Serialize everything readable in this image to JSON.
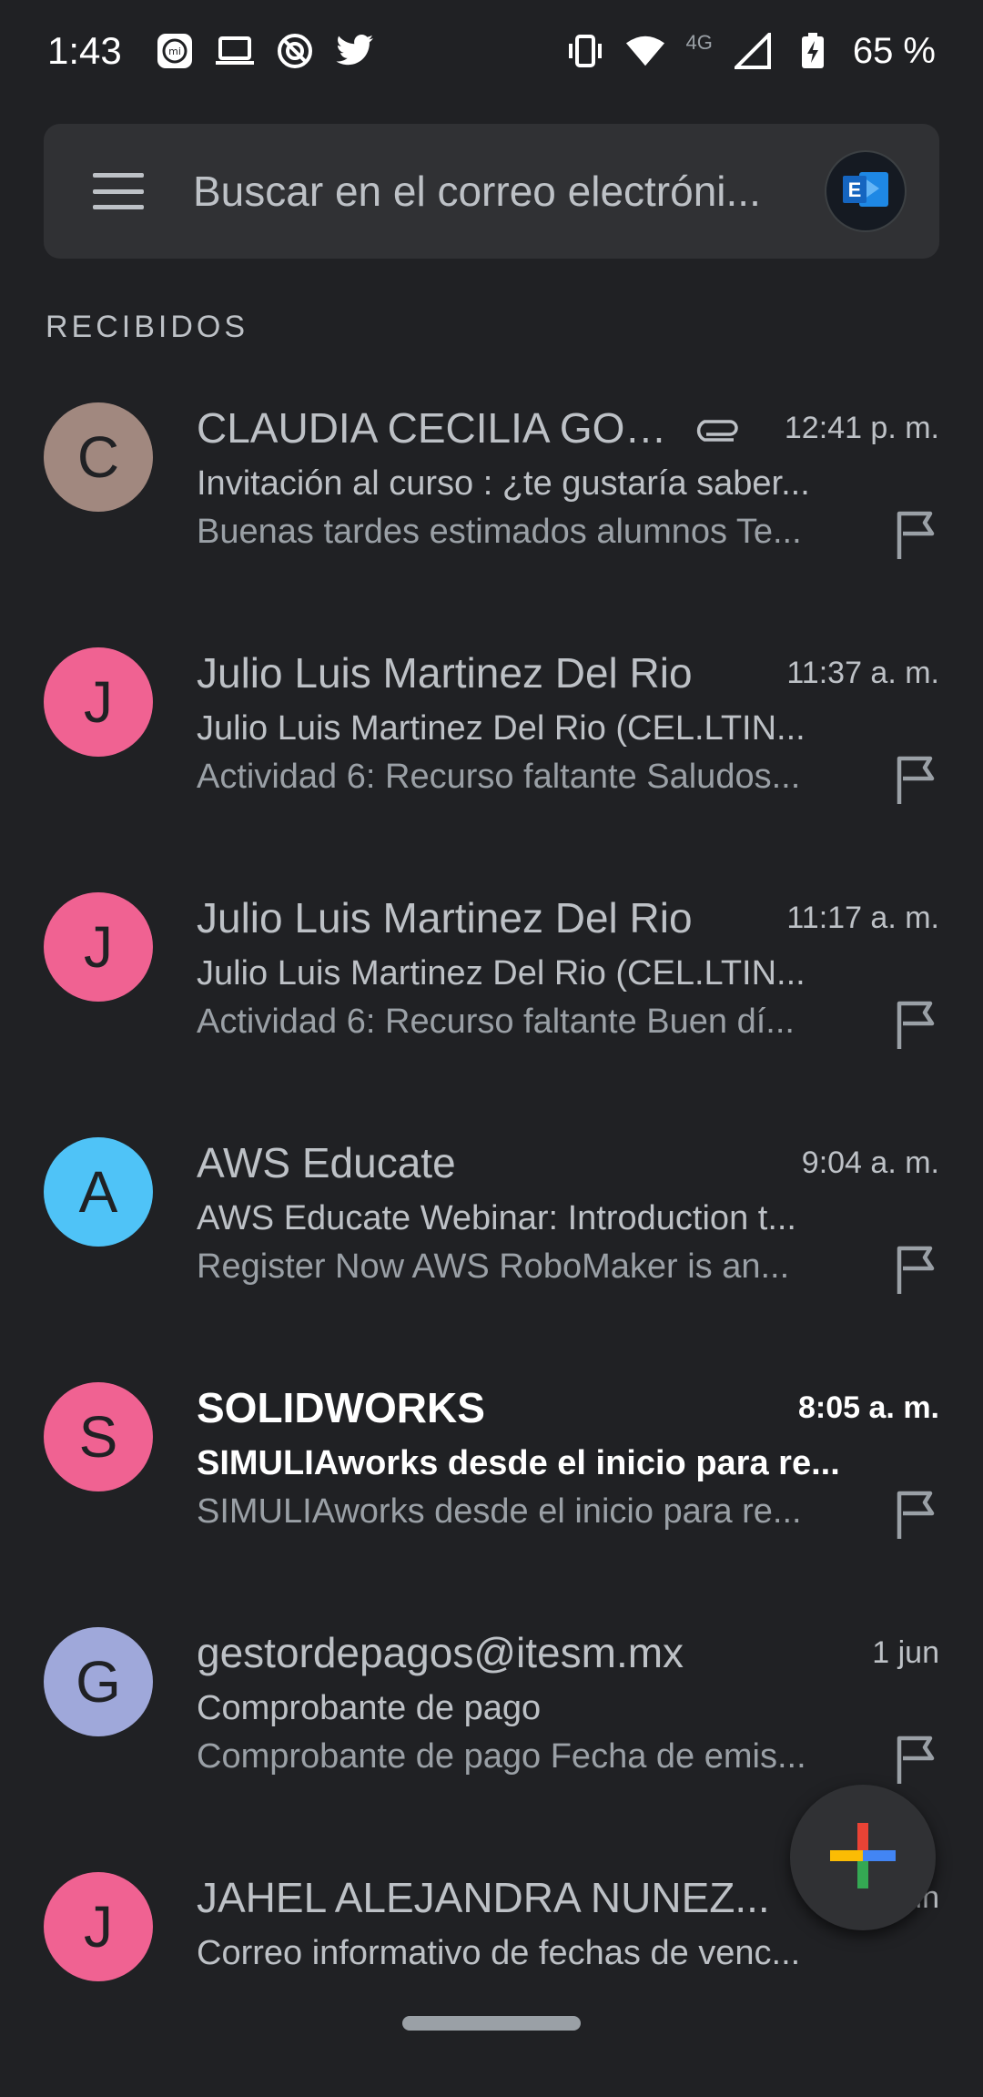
{
  "status_bar": {
    "time": "1:43",
    "network_label": "4G",
    "battery": "65 %",
    "icons": [
      "mi-icon",
      "laptop-icon",
      "sync-icon",
      "twitter-icon",
      "vibrate-icon",
      "wifi-icon",
      "signal-icon",
      "battery-icon"
    ]
  },
  "search": {
    "placeholder": "Buscar en el correo electróni...",
    "account_icon": "exchange-icon"
  },
  "section_label": "RECIBIDOS",
  "colors": {
    "background": "#202124",
    "surface": "#303134",
    "avatar_brown": "#a1887f",
    "avatar_pink": "#f06292",
    "avatar_blue": "#4fc3f7",
    "avatar_lavender": "#9fa8da"
  },
  "emails": [
    {
      "initial": "C",
      "sender": "CLAUDIA CECILIA GON...",
      "time": "12:41 p. m.",
      "subject": "Invitación al curso : ¿te gustaría saber...",
      "snippet": "Buenas tardes estimados alumnos Te...",
      "attachment": true,
      "unread": false,
      "avatar_color": "#a1887f"
    },
    {
      "initial": "J",
      "sender": "Julio Luis Martinez Del Rio",
      "time": "11:37 a. m.",
      "subject": "Julio Luis Martinez Del Rio (CEL.LTIN...",
      "snippet": "Actividad 6: Recurso faltante Saludos...",
      "attachment": false,
      "unread": false,
      "avatar_color": "#f06292"
    },
    {
      "initial": "J",
      "sender": "Julio Luis Martinez Del Rio",
      "time": "11:17 a. m.",
      "subject": "Julio Luis Martinez Del Rio (CEL.LTIN...",
      "snippet": "Actividad 6: Recurso faltante Buen dí...",
      "attachment": false,
      "unread": false,
      "avatar_color": "#f06292"
    },
    {
      "initial": "A",
      "sender": "AWS Educate",
      "time": "9:04 a. m.",
      "subject": "AWS Educate Webinar: Introduction t...",
      "snippet": "Register Now AWS RoboMaker is an...",
      "attachment": false,
      "unread": false,
      "avatar_color": "#4fc3f7"
    },
    {
      "initial": "S",
      "sender": "SOLIDWORKS",
      "time": "8:05 a. m.",
      "subject": "SIMULIAworks desde el inicio para re...",
      "snippet": "SIMULIAworks desde el inicio para re...",
      "attachment": false,
      "unread": true,
      "avatar_color": "#f06292"
    },
    {
      "initial": "G",
      "sender": "gestordepagos@itesm.mx",
      "time": "1 jun",
      "subject": "Comprobante de pago",
      "snippet": "Comprobante de pago Fecha de emis...",
      "attachment": false,
      "unread": false,
      "avatar_color": "#9fa8da"
    },
    {
      "initial": "J",
      "sender": "JAHEL ALEJANDRA NUNEZ...",
      "time": "1 jun",
      "subject": "Correo informativo de fechas de venc...",
      "snippet": "",
      "attachment": false,
      "unread": false,
      "avatar_color": "#f06292"
    }
  ],
  "fab": {
    "icon": "compose-plus-icon"
  }
}
